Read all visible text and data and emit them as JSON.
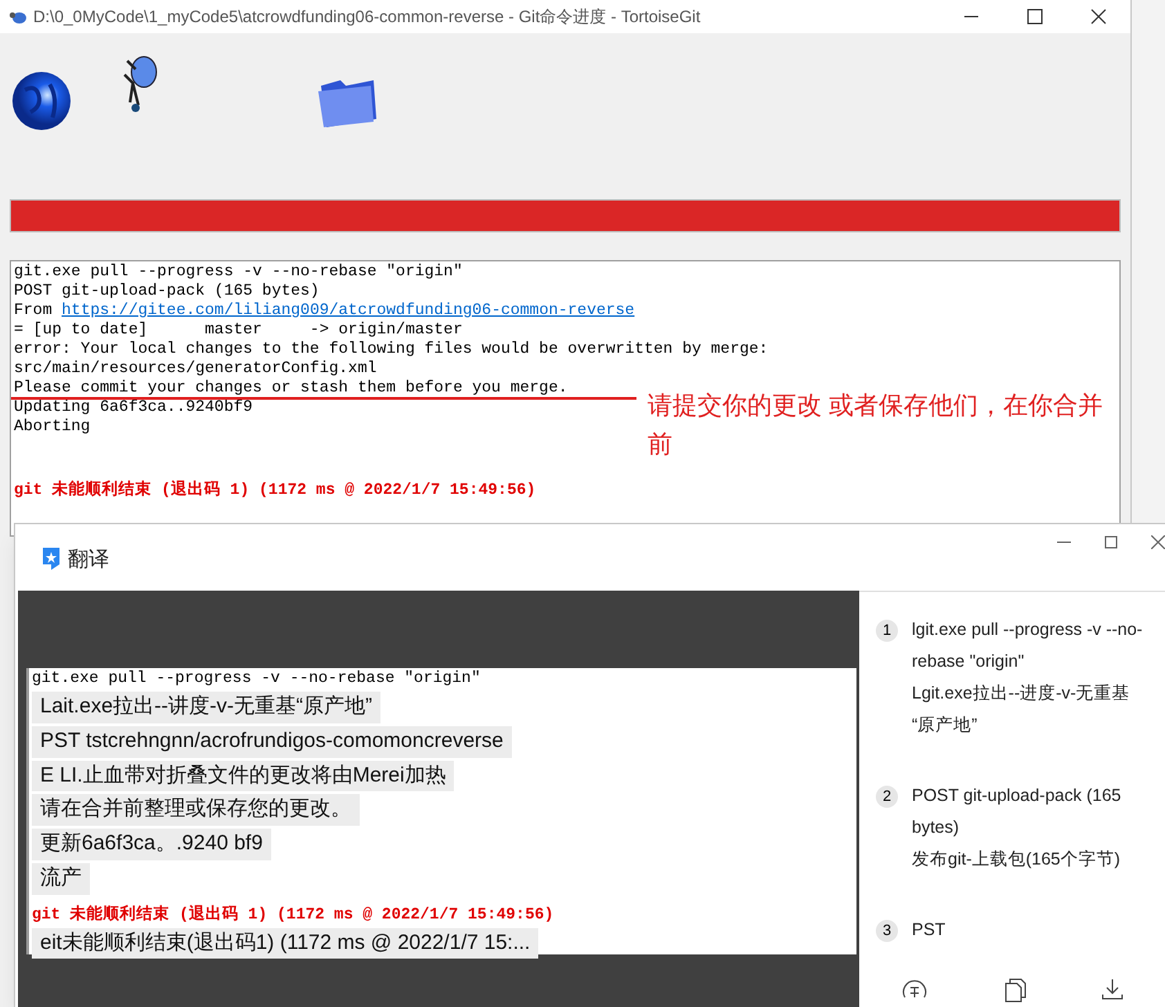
{
  "main_window": {
    "title": "D:\\0_0MyCode\\1_myCode5\\atcrowdfunding06-common-reverse - Git命令进度 - TortoiseGit",
    "progress": {
      "level": 1
    },
    "log_lines": [
      {
        "kind": "plain",
        "text": "git.exe pull --progress -v --no-rebase \"origin\""
      },
      {
        "kind": "plain",
        "text": "POST git-upload-pack (165 bytes)"
      },
      {
        "kind": "link",
        "prefix": "From ",
        "link": "https://gitee.com/liliang009/atcrowdfunding06-common-reverse"
      },
      {
        "kind": "plain",
        "text": "= [up to date]      master     -> origin/master"
      },
      {
        "kind": "plain",
        "text": "error: Your local changes to the following files would be overwritten by merge:"
      },
      {
        "kind": "plain",
        "text": "src/main/resources/generatorConfig.xml"
      },
      {
        "kind": "plain",
        "text": "Please commit your changes or stash them before you merge."
      },
      {
        "kind": "plain",
        "text": "Updating 6a6f3ca..9240bf9"
      },
      {
        "kind": "plain",
        "text": "Aborting"
      },
      {
        "kind": "error",
        "text": "git 未能顺利结束 (退出码 1) (1172 ms @ 2022/1/7 15:49:56)"
      }
    ],
    "annotation": "请提交你的更改  或者保存他们，在你合并前"
  },
  "translator_window": {
    "title": "翻译",
    "screenshot_lines": [
      {
        "kind": "source",
        "text": "git.exe pull --progress -v --no-rebase \"origin\""
      },
      {
        "kind": "overlay",
        "text": "Lait.exe拉出--讲度-v-无重基“原产地”"
      },
      {
        "kind": "overlay",
        "text": "PST tstcrehngnn/acrofrundigos-comomoncreverse"
      },
      {
        "kind": "overlay",
        "text": "E LI.止血带对折叠文件的更改将由Merei加热"
      },
      {
        "kind": "overlay",
        "text": "请在合并前整理或保存您的更改。"
      },
      {
        "kind": "overlay",
        "text": "更新6a6f3ca。.9240 bf9"
      },
      {
        "kind": "overlay",
        "text": "流产"
      },
      {
        "kind": "error",
        "text": "git 未能顺利结束 (退出码 1) (1172 ms @ 2022/1/7 15:49:56)"
      },
      {
        "kind": "overlay",
        "text": "eit未能顺利结束(退出码1) (1172 ms @ 2022/1/7 15:..."
      }
    ],
    "results": [
      {
        "number": "1",
        "lines": [
          "lgit.exe pull --progress -v --no-rebase \"origin\"",
          "Lgit.exe拉出--进度-v-无重基 “原产地”"
        ]
      },
      {
        "number": "2",
        "lines": [
          "POST git-upload-pack (165 bytes)",
          "发布git-上载包(165个字节)"
        ]
      },
      {
        "number": "3",
        "lines": [
          "PST"
        ]
      }
    ]
  }
}
